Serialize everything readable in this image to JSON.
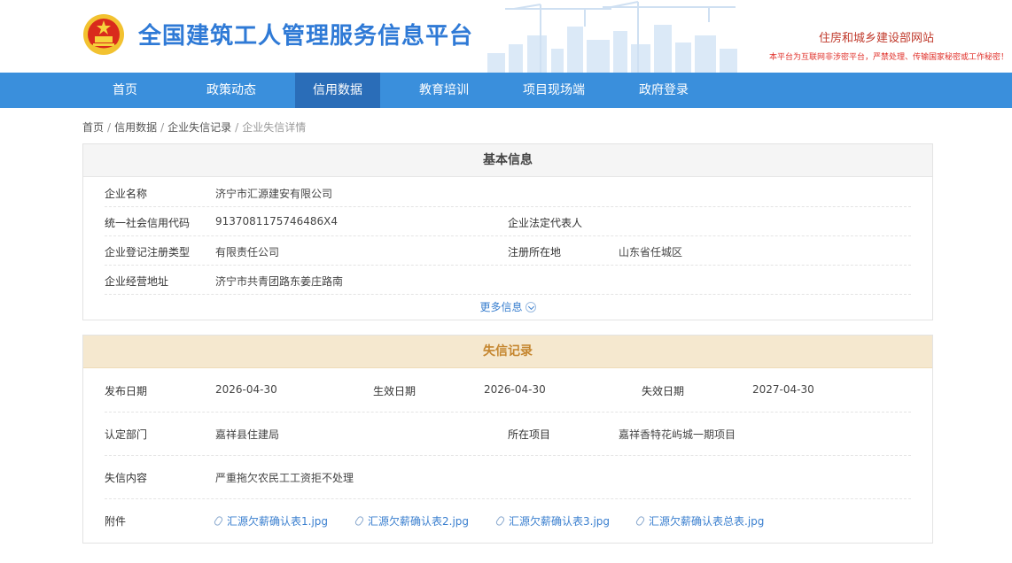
{
  "header": {
    "site_title": "全国建筑工人管理服务信息平台",
    "ministry_link": "住房和城乡建设部网站",
    "warning": "本平台为互联网非涉密平台，严禁处理、传输国家秘密或工作秘密！"
  },
  "nav": {
    "items": [
      {
        "label": "首页"
      },
      {
        "label": "政策动态"
      },
      {
        "label": "信用数据"
      },
      {
        "label": "教育培训"
      },
      {
        "label": "项目现场端"
      },
      {
        "label": "政府登录"
      }
    ],
    "active_index": 2,
    "colors": {
      "bar": "#3a8fdc",
      "active": "#2a6db8"
    }
  },
  "breadcrumb": [
    "首页",
    "信用数据",
    "企业失信记录",
    "企业失信详情"
  ],
  "basic_info": {
    "title": "基本信息",
    "company_name_label": "企业名称",
    "company_name": "济宁市汇源建安有限公司",
    "credit_code_label": "统一社会信用代码",
    "credit_code": "9137081175746486X4",
    "legal_rep_label": "企业法定代表人",
    "legal_rep": "",
    "reg_type_label": "企业登记注册类型",
    "reg_type": "有限责任公司",
    "reg_place_label": "注册所在地",
    "reg_place": "山东省任城区",
    "address_label": "企业经营地址",
    "address": "济宁市共青团路东姜庄路南",
    "more_label": "更多信息"
  },
  "credit_record": {
    "title": "失信记录",
    "publish_date_label": "发布日期",
    "publish_date": "2026-04-30",
    "effective_date_label": "生效日期",
    "effective_date": "2026-04-30",
    "expire_date_label": "失效日期",
    "expire_date": "2027-04-30",
    "department_label": "认定部门",
    "department": "嘉祥县住建局",
    "project_label": "所在项目",
    "project": "嘉祥香特花屿城一期项目",
    "content_label": "失信内容",
    "content": "严重拖欠农民工工资拒不处理",
    "attachments_label": "附件",
    "attachments": [
      "汇源欠薪确认表1.jpg",
      "汇源欠薪确认表2.jpg",
      "汇源欠薪确认表3.jpg",
      "汇源欠薪确认表总表.jpg"
    ],
    "colors": {
      "head_bg": "#f5e8cf",
      "head_text": "#c5862f"
    }
  }
}
